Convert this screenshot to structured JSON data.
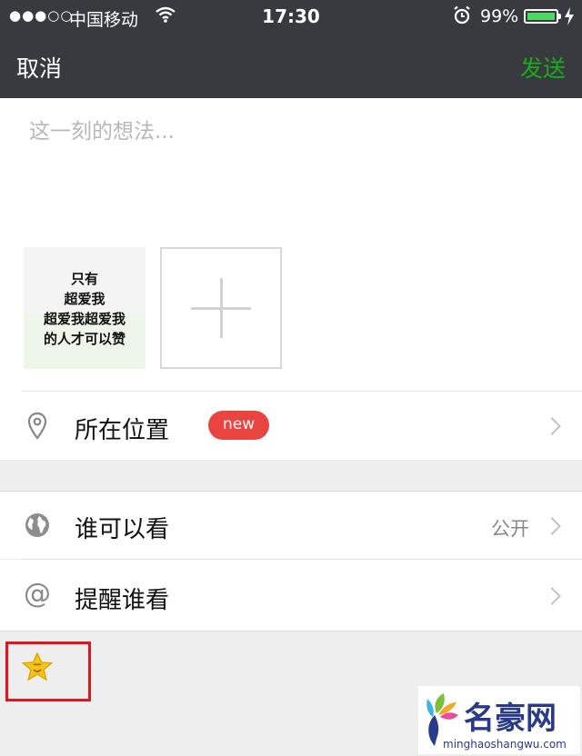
{
  "status_bar": {
    "signal": "●●●○○",
    "carrier": "中国移动",
    "time": "17:30",
    "battery": "99%",
    "battery_level": 0.99,
    "battery_color": "#4cd964",
    "icons": [
      "wifi-icon",
      "alarm-icon",
      "battery-icon",
      "charging-icon"
    ]
  },
  "nav": {
    "cancel_label": "取消",
    "send_label": "发送",
    "send_color": "#1aad19"
  },
  "compose": {
    "placeholder": "这一刻的想法...",
    "photo_text": [
      "只有",
      "超爱我",
      "超爱我超爱我",
      "的人才可以赞"
    ],
    "add_icon": "plus-icon"
  },
  "location": {
    "label": "所在位置",
    "badge": "new",
    "badge_color": "#e94440",
    "icon": "location-pin-icon"
  },
  "visibility": {
    "label": "谁可以看",
    "value": "公开",
    "icon": "globe-icon"
  },
  "mention": {
    "label": "提醒谁看",
    "icon": "at-icon"
  },
  "emoji_toolbar": {
    "icon": "star-face-icon",
    "highlight_color": "#e5131c"
  },
  "watermark": {
    "title": "名豪网",
    "url": "minghaoshangwu.com"
  }
}
